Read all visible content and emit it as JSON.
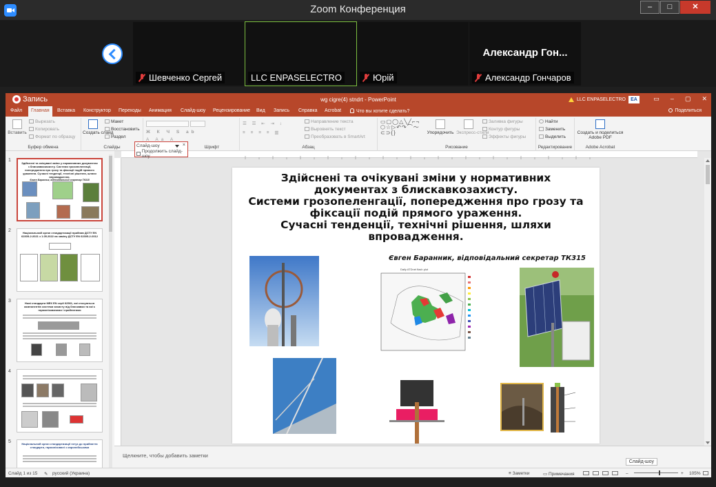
{
  "zoom": {
    "title": "Zoom Конференция",
    "window_buttons": [
      "–",
      "□",
      "✕"
    ],
    "participants": [
      {
        "name": "Шевченко Сергей",
        "muted": true,
        "active": false
      },
      {
        "name": "LLC ENPASELECTRO",
        "muted": false,
        "active": true
      },
      {
        "name": "Юрій",
        "muted": true,
        "active": false
      },
      {
        "name": "Александр Гончаров",
        "big_label": "Александр Гон...",
        "muted": true,
        "active": false
      }
    ]
  },
  "ppt": {
    "recording_label": "Запись",
    "file_title": "wg cigre(4) stndrt - PowerPoint",
    "account": "LLC ENPASELECTRO",
    "account_logo": "EA",
    "title_buttons": [
      "▭",
      "–",
      "▢",
      "✕"
    ],
    "tabs": [
      "Файл",
      "Главная",
      "Вставка",
      "Конструктор",
      "Переходы",
      "Анимация",
      "Слайд-шоу",
      "Рецензирование",
      "Вид",
      "Запись",
      "Справка",
      "Acrobat"
    ],
    "selected_tab": "Главная",
    "tell_me": "Что вы хотите сделать?",
    "share": "Поделиться",
    "ribbon": {
      "clipboard": {
        "paste": "Вставить",
        "cut": "Вырезать",
        "copy": "Копировать",
        "format": "Формат по образцу",
        "label": "Буфер обмена"
      },
      "slides": {
        "new": "Создать слайд",
        "layout": "Макет",
        "reset": "Восстановить",
        "section": "Раздел",
        "label": "Слайды"
      },
      "font_label": "Шрифт",
      "paragraph": {
        "direction": "Направление текста",
        "align": "Выровнять текст",
        "smartart": "Преобразовать в SmartArt",
        "label": "Абзац"
      },
      "drawing": {
        "arrange": "Упорядочить",
        "quick": "Экспресс-стили",
        "fill": "Заливка фигуры",
        "outline": "Контур фигуры",
        "effects": "Эффекты фигуры",
        "label": "Рисование"
      },
      "editing": {
        "find": "Найти",
        "replace": "Заменить",
        "select": "Выделить",
        "label": "Редактирование"
      },
      "acrobat": {
        "create": "Создать и поделиться",
        "pdf": "Adobe PDF",
        "label": "Adobe Acrobat"
      }
    },
    "dropdown": {
      "selected": "Слайд-шоу",
      "option": "Продолжить слайд-шоу"
    },
    "thumbnails": [
      {
        "num": "1",
        "title": "Здійснені та очікувані зміни у нормативних документах з блискавкозахисту. Системи грозопеленгації, попередження про грозу та фіксації подій прямого ураження. Сучасні тенденції, технічні рішення, шляхи впровадження.",
        "sub": "Євген Баранник, відповідальний секретар ТК315"
      },
      {
        "num": "2",
        "title": "Національний орган стандартизації прийняв ДСТУ EN 62305-2:2021 з 1.05.2022 на заміну ДСТУ EN 62305-2:2012"
      },
      {
        "num": "3",
        "title": "Нові стандарти МЕК EN серії 62561, які стосуються компонентів системи захисту від блискавки та які є гармонізованими і прийнятими"
      },
      {
        "num": "4",
        "title": ""
      },
      {
        "num": "5",
        "title": "Національний орган стандартизації готує до прийняття стандарти, гармонізовані з європейськими"
      }
    ],
    "slide": {
      "title_lines": [
        "Здійснені та очікувані зміни у нормативних",
        "документах з блискавкозахисту.",
        "Системи грозопеленгації, попередження про грозу та",
        "фіксації подій прямого ураження.",
        "Сучасні тенденції, технічні рішення, шляхи",
        "впровадження."
      ],
      "author": "Євген Баранник, відповідальний секретар ТК315",
      "map_title": "Daily ATDnet flash plot"
    },
    "notes_placeholder": "Щелкните, чтобы добавить заметки",
    "slideshow_tip": "Слайд-шоу",
    "status": {
      "slide_count": "Слайд 1 из 15",
      "language": "русский (Украина)",
      "notes": "Заметки",
      "comments": "Примечания",
      "zoom": "105%"
    }
  }
}
